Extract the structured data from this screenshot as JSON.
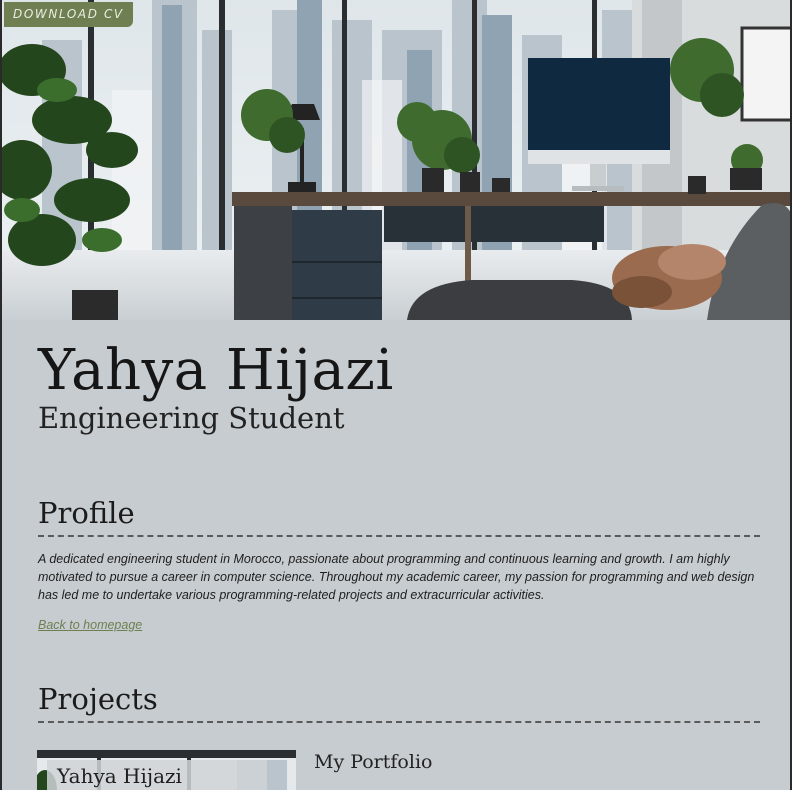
{
  "hero": {
    "download_label": "DOWNLOAD CV"
  },
  "header": {
    "name": "Yahya Hijazi",
    "role": "Engineering Student"
  },
  "profile": {
    "title": "Profile",
    "text": "A dedicated engineering student in Morocco, passionate about programming and continuous learning and growth. I am highly motivated to pursue a career in computer science. Throughout my academic career, my passion for programming and web design has led me to undertake various programming-related projects and extracurricular activities.",
    "back_link": "Back to homepage"
  },
  "projects": {
    "title": "Projects",
    "items": [
      {
        "title": "My Portfolio",
        "thumb_text": "Yahya Hijazi"
      }
    ]
  },
  "colors": {
    "background": "#c7ccd0",
    "accent": "#6f7f52",
    "text": "#1b1b1b"
  }
}
